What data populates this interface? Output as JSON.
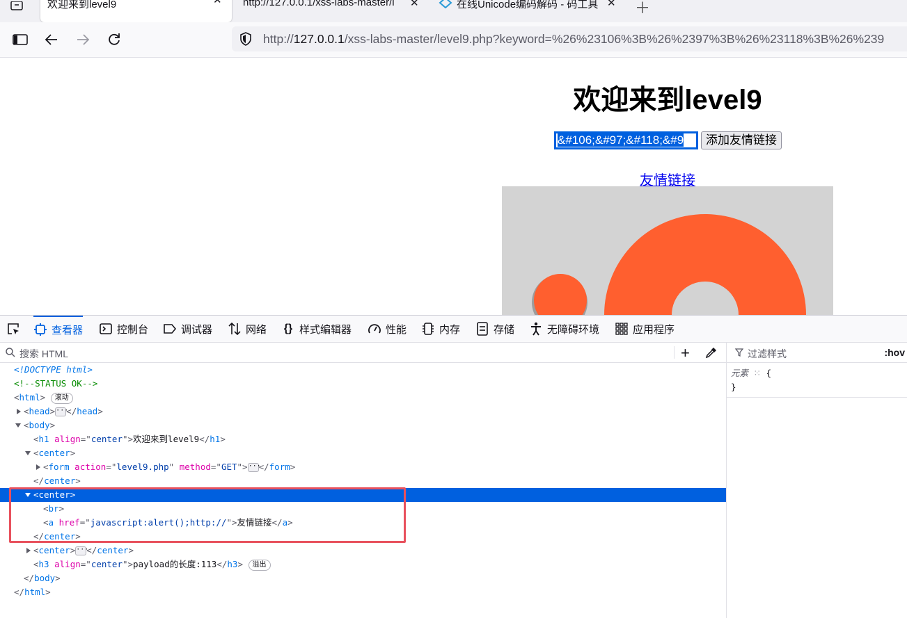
{
  "tabs": [
    {
      "title": "欢迎来到level9",
      "active": true
    },
    {
      "title": "http://127.0.0.1/xss-labs-master/l",
      "active": false
    },
    {
      "title": "在线Unicode编码解码 - 码工具",
      "active": false
    }
  ],
  "navbar": {
    "url_host": "127.0.0.1",
    "url_scheme": "http://",
    "url_rest": "/xss-labs-master/level9.php?keyword=%26%23106%3B%26%2397%3B%26%23118%3B%26%239"
  },
  "page": {
    "heading": "欢迎来到level9",
    "input_value": "&#106;&#97;&#118;&#9",
    "submit_label": "添加友情链接",
    "link_text": "友情链接"
  },
  "devtools": {
    "tabs": [
      {
        "label": "查看器",
        "icon": "inspector-icon",
        "selected": true
      },
      {
        "label": "控制台",
        "icon": "console-icon",
        "selected": false
      },
      {
        "label": "调试器",
        "icon": "debugger-icon",
        "selected": false
      },
      {
        "label": "网络",
        "icon": "network-icon",
        "selected": false
      },
      {
        "label": "样式编辑器",
        "icon": "style-editor-icon",
        "selected": false
      },
      {
        "label": "性能",
        "icon": "performance-icon",
        "selected": false
      },
      {
        "label": "内存",
        "icon": "memory-icon",
        "selected": false
      },
      {
        "label": "存储",
        "icon": "storage-icon",
        "selected": false
      },
      {
        "label": "无障碍环境",
        "icon": "accessibility-icon",
        "selected": false
      },
      {
        "label": "应用程序",
        "icon": "application-icon",
        "selected": false
      }
    ],
    "search_placeholder": "搜索 HTML",
    "filter_placeholder": "过滤样式",
    "hov_label": ":hov",
    "rule_selector": "元素",
    "rule_open": "{",
    "rule_close": "}",
    "badges": {
      "scroll": "滚动",
      "overflow": "溢出"
    },
    "tree": {
      "doctype": "<!DOCTYPE html>",
      "comment": "<!--STATUS OK-->",
      "h1_text": "欢迎来到level9",
      "form_action": "level9.php",
      "form_method": "GET",
      "a_href": "javascript:alert();http://",
      "a_text": "友情链接",
      "h3_text": "payload的长度:113"
    }
  },
  "colors": {
    "accent": "#0060df",
    "highlight_box": "#e8515d",
    "logo_orange": "#ff5f2f"
  }
}
